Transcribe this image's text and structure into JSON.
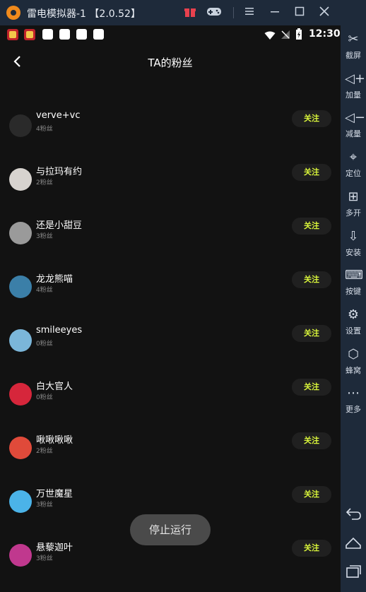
{
  "window": {
    "title": "雷电模拟器-1 【2.0.52】",
    "icons": [
      "gift-icon",
      "gamepad-icon",
      "menu-icon",
      "minimize-icon",
      "maximize-icon",
      "close-icon",
      "collapse-icon"
    ]
  },
  "statusbar": {
    "time": "12:30"
  },
  "page": {
    "title": "TA的粉丝"
  },
  "followers": [
    {
      "name": "verve+vc",
      "fans": "4粉丝",
      "button": "关注",
      "avatar_color": "#2a2a2a"
    },
    {
      "name": "与拉玛有约",
      "fans": "2粉丝",
      "button": "关注",
      "avatar_color": "#d7d3cf"
    },
    {
      "name": "还是小甜豆",
      "fans": "3粉丝",
      "button": "关注",
      "avatar_color": "#9a9a9a"
    },
    {
      "name": "龙龙熊喵",
      "fans": "4粉丝",
      "button": "关注",
      "avatar_color": "#3b7fa8"
    },
    {
      "name": "smileeyes",
      "fans": "0粉丝",
      "button": "关注",
      "avatar_color": "#7bb6d9"
    },
    {
      "name": "白大官人",
      "fans": "0粉丝",
      "button": "关注",
      "avatar_color": "#d6263b"
    },
    {
      "name": "啾啾啾啾",
      "fans": "2粉丝",
      "button": "关注",
      "avatar_color": "#e04a3a"
    },
    {
      "name": "万世魔星",
      "fans": "3粉丝",
      "button": "关注",
      "avatar_color": "#4bb3e8"
    },
    {
      "name": "悬藜迦叶",
      "fans": "3粉丝",
      "button": "关注",
      "avatar_color": "#c0388e"
    }
  ],
  "toast": "停止运行",
  "sidebar": {
    "items": [
      {
        "label": "截屏",
        "icon": "scissors-icon"
      },
      {
        "label": "加量",
        "icon": "volume-up-icon"
      },
      {
        "label": "减量",
        "icon": "volume-down-icon"
      },
      {
        "label": "定位",
        "icon": "location-icon"
      },
      {
        "label": "多开",
        "icon": "multi-open-icon"
      },
      {
        "label": "安装",
        "icon": "apk-install-icon"
      },
      {
        "label": "按键",
        "icon": "keyboard-icon"
      },
      {
        "label": "设置",
        "icon": "gear-icon"
      },
      {
        "label": "蜂窝",
        "icon": "beehive-icon"
      },
      {
        "label": "更多",
        "icon": "more-icon"
      }
    ],
    "nav": [
      "back-icon",
      "home-icon",
      "recents-icon"
    ]
  },
  "colors": {
    "accent": "#d9f53a",
    "background": "#121212",
    "chrome": "#1e2a3a"
  }
}
